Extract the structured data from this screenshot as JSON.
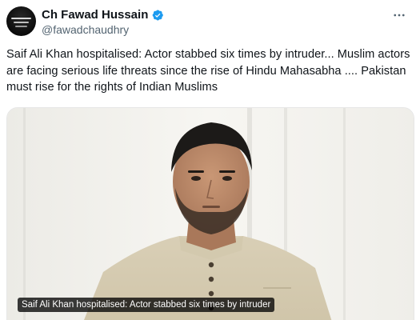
{
  "author": {
    "display_name": "Ch Fawad Hussain",
    "handle": "@fawadchaudhry",
    "verified": true,
    "verified_color": "#1d9bf0"
  },
  "tweet": {
    "text": "Saif Ali Khan hospitalised: Actor stabbed six times by intruder... Muslim actors are facing serious life threats since the rise of Hindu Mahasabha .... Pakistan must rise for the rights of Indian Muslims"
  },
  "media": {
    "caption": "Saif Ali Khan hospitalised: Actor stabbed six times by intruder"
  },
  "icons": {
    "more": "more-horizontal-icon",
    "verified": "verified-badge-icon"
  }
}
